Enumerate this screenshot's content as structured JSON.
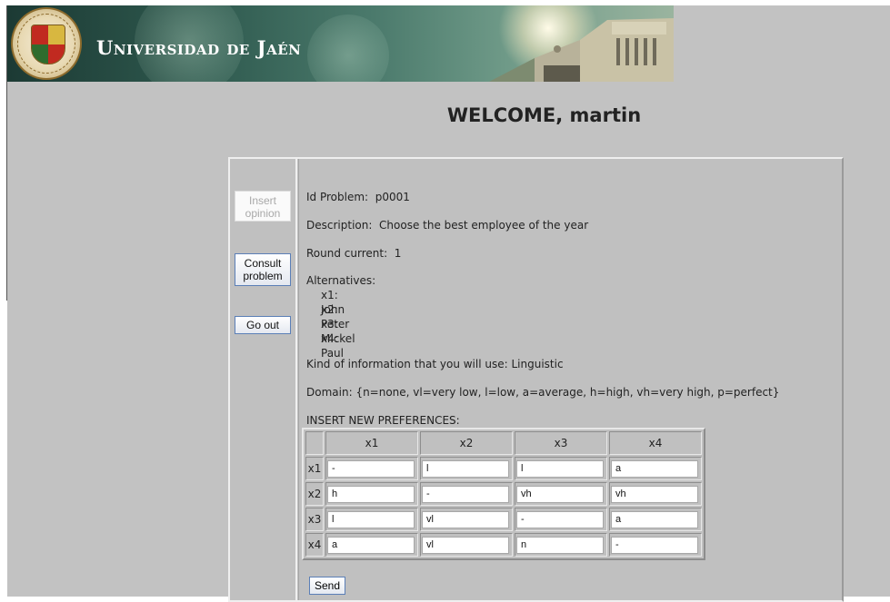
{
  "banner": {
    "title": "Universidad de Jaén",
    "seal_icon": "university-seal-icon",
    "accent_color": "#2f5a4f"
  },
  "welcome": "WELCOME, martin",
  "menu": {
    "insert_opinion": "Insert opinion",
    "consult_problem": "Consult problem",
    "go_out": "Go out"
  },
  "problem": {
    "id_label": "Id Problem:",
    "id_value": "p0001",
    "description_label": "Description:",
    "description_value": "Choose the best employee of the year",
    "round_label": "Round current:",
    "round_value": "1",
    "alternatives_label": "Alternatives:",
    "alternatives": [
      "x1: John",
      "x2: Peter",
      "x3: Mickel",
      "x4: Paul"
    ],
    "info_label": "Kind of information that you will use:",
    "info_value": "Linguistic",
    "domain_label": "Domain:",
    "domain_value": "{n=none, vl=very low, l=low, a=average, h=high, vh=very high, p=perfect}",
    "insert_label": "INSERT NEW PREFERENCES:"
  },
  "preferences": {
    "columns": [
      "x1",
      "x2",
      "x3",
      "x4"
    ],
    "rows": [
      {
        "label": "x1",
        "values": [
          "-",
          "l",
          "l",
          "a"
        ]
      },
      {
        "label": "x2",
        "values": [
          "h",
          "-",
          "vh",
          "vh"
        ]
      },
      {
        "label": "x3",
        "values": [
          "l",
          "vl",
          "-",
          "a"
        ]
      },
      {
        "label": "x4",
        "values": [
          "a",
          "vl",
          "n",
          "-"
        ]
      }
    ]
  },
  "send_label": "Send"
}
